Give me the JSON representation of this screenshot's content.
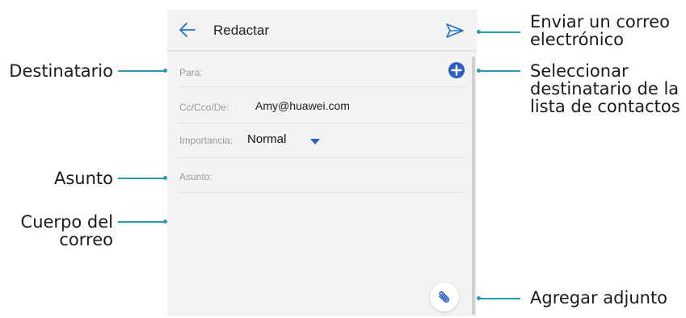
{
  "screen": {
    "title": "Redactar",
    "fields": {
      "to_label": "Para:",
      "cc_label": "Cc/Cco/De:",
      "cc_value": "Amy@huawei.com",
      "importance_label": "Importancia:",
      "importance_value": "Normal",
      "subject_label": "Asunto:"
    },
    "icons": {
      "back": "back-arrow-icon",
      "send": "send-icon",
      "add_recipient": "add-circle-icon",
      "dropdown": "dropdown-triangle-icon",
      "attach": "paperclip-icon"
    }
  },
  "annotations": {
    "left": {
      "recipient": "Destinatario",
      "subject": "Asunto",
      "body": "Cuerpo del\ncorreo"
    },
    "right": {
      "send": "Enviar un correo\nelectrónico",
      "select_recipient": "Seleccionar\ndestinatario de la\nlista de contactos",
      "add_attachment": "Agregar adjunto"
    }
  },
  "colors": {
    "leader": "#2a9ab1",
    "accent": "#1a73c8"
  }
}
